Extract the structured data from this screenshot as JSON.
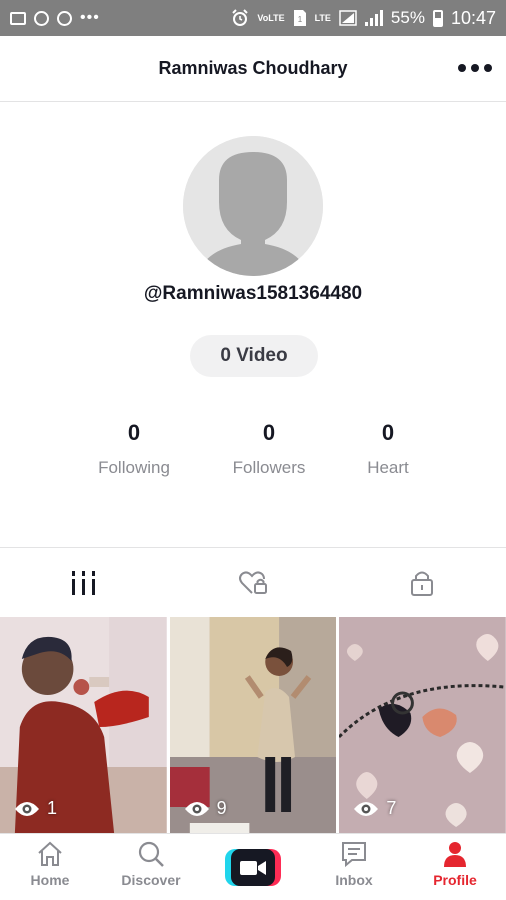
{
  "status_bar": {
    "volte": "VoLTE",
    "lte": "LTE",
    "battery": "55%",
    "time": "10:47"
  },
  "header": {
    "title": "Ramniwas Choudhary"
  },
  "profile": {
    "username": "@Ramniwas1581364480",
    "video_count": "0 Video",
    "stats": [
      {
        "value": "0",
        "label": "Following"
      },
      {
        "value": "0",
        "label": "Followers"
      },
      {
        "value": "0",
        "label": "Heart"
      }
    ]
  },
  "tabs": [
    {
      "icon": "grid-videos-icon"
    },
    {
      "icon": "liked-heart-lock-icon"
    },
    {
      "icon": "private-lock-icon"
    }
  ],
  "videos": [
    {
      "views": "1"
    },
    {
      "views": "9"
    },
    {
      "views": "7"
    }
  ],
  "nav": {
    "home": "Home",
    "discover": "Discover",
    "inbox": "Inbox",
    "profile": "Profile"
  },
  "colors": {
    "active": "#e5262f",
    "inactive": "#8a8b91",
    "status_bar": "#7f7f7f"
  }
}
